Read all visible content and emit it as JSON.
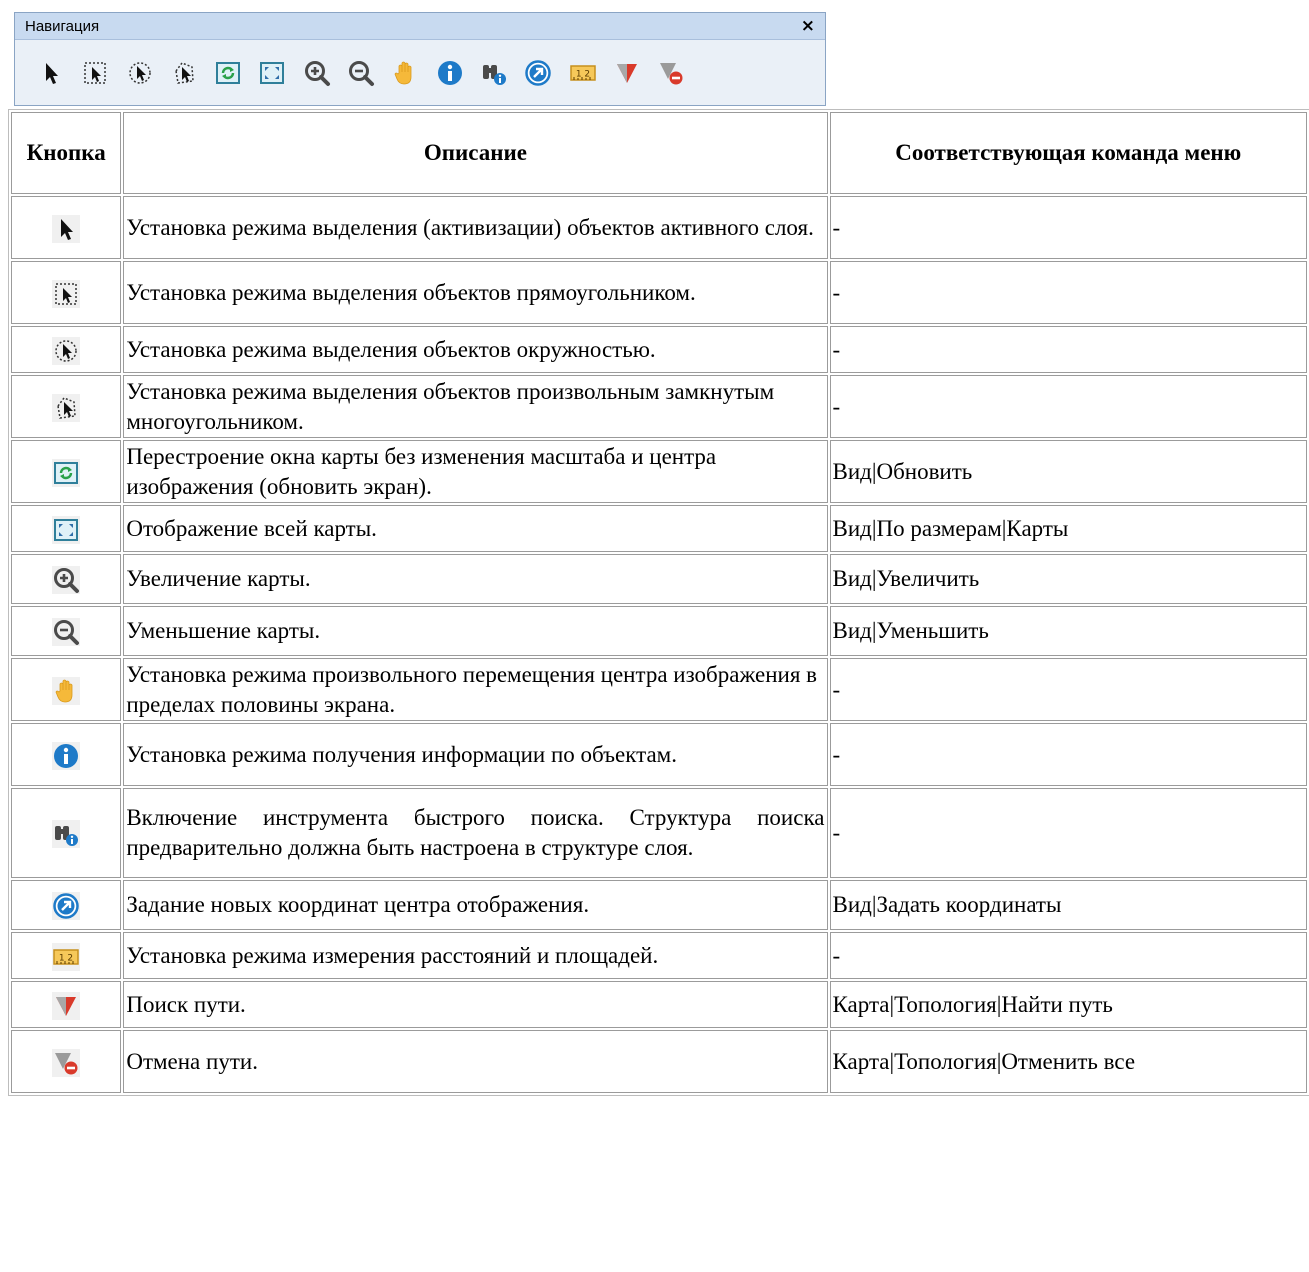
{
  "toolbar": {
    "title": "Навигация",
    "close_glyph": "×",
    "buttons": [
      "select-arrow-icon",
      "rect-select-icon",
      "circle-select-icon",
      "polygon-select-icon",
      "refresh-map-icon",
      "full-extent-icon",
      "zoom-in-icon",
      "zoom-out-icon",
      "pan-hand-icon",
      "info-icon",
      "quick-search-icon",
      "goto-coordinates-icon",
      "measure-icon",
      "find-path-icon",
      "cancel-path-icon"
    ]
  },
  "table": {
    "headers": [
      "Кнопка",
      "Описание",
      "Соответствующая команда меню"
    ],
    "rows": [
      {
        "icon": "select-arrow-icon",
        "description": "Установка режима выделения (активизации) объектов активного слоя.",
        "command": "-"
      },
      {
        "icon": "rect-select-icon",
        "description": "Установка режима выделения объектов прямоугольником.",
        "command": "-"
      },
      {
        "icon": "circle-select-icon",
        "description": "Установка режима выделения объектов окружностью.",
        "command": "-"
      },
      {
        "icon": "polygon-select-icon",
        "description": "Установка режима выделения объектов произвольным замкнутым многоугольником.",
        "command": "-"
      },
      {
        "icon": "refresh-map-icon",
        "description": "Перестроение окна карты без изменения масштаба и центра изображения (обновить экран).",
        "command": "Вид|Обновить"
      },
      {
        "icon": "full-extent-icon",
        "description": "Отображение всей карты.",
        "command": "Вид|По размерам|Карты"
      },
      {
        "icon": "zoom-in-icon",
        "description": "Увеличение карты.",
        "command": "Вид|Увеличить"
      },
      {
        "icon": "zoom-out-icon",
        "description": "Уменьшение карты.",
        "command": "Вид|Уменьшить"
      },
      {
        "icon": "pan-hand-icon",
        "description": "Установка режима произвольного перемещения центра изображения в пределах половины экрана.",
        "command": "-"
      },
      {
        "icon": "info-icon",
        "description": "Установка режима получения информации по объектам.",
        "command": "-"
      },
      {
        "icon": "quick-search-icon",
        "description": "Включение инструмента быстрого поиска. Структура поиска предварительно должна быть настроена в структуре слоя.",
        "command": "-"
      },
      {
        "icon": "goto-coordinates-icon",
        "description": "Задание новых координат центра отображения.",
        "command": "Вид|Задать координаты"
      },
      {
        "icon": "measure-icon",
        "description": "Установка режима измерения расстояний и площадей.",
        "command": "-"
      },
      {
        "icon": "find-path-icon",
        "description": "Поиск пути.",
        "command": "Карта|Топология|Найти путь"
      },
      {
        "icon": "cancel-path-icon",
        "description": "Отмена пути.",
        "command": "Карта|Топология|Отменить все"
      }
    ]
  }
}
